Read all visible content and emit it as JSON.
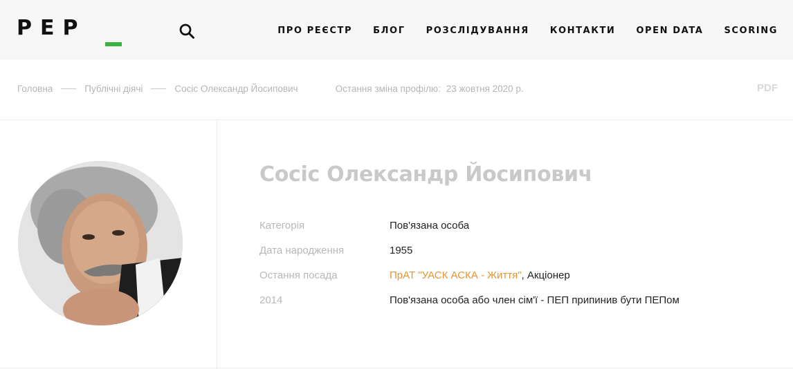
{
  "header": {
    "logo_text": "PEP",
    "nav": [
      {
        "label": "ПРО РЕЄСТР"
      },
      {
        "label": "БЛОГ"
      },
      {
        "label": "РОЗСЛІДУВАННЯ"
      },
      {
        "label": "КОНТАКТИ"
      },
      {
        "label": "OPEN DATA"
      },
      {
        "label": "SCORING"
      }
    ],
    "search_icon": "search-icon",
    "accent_color": "#3fb33f"
  },
  "breadcrumb": {
    "items": [
      "Головна",
      "Публічні діячі",
      "Сосіс Олександр Йосипович"
    ],
    "last_change_label": "Остання зміна профілю:",
    "last_change_value": "23 жовтня 2020 р.",
    "pdf_label": "PDF"
  },
  "profile": {
    "name": "Сосіс Олександр Йосипович",
    "rows": [
      {
        "label": "Категорія",
        "value": "Пов'язана особа"
      },
      {
        "label": "Дата народження",
        "value": "1955"
      },
      {
        "label": "Остання посада",
        "link": "ПрАТ \"УАСК АСКА - Життя\"",
        "suffix": ", Акціонер"
      },
      {
        "label": "2014",
        "value": "Пов'язана особа або член сім'ї - ПЕП припинив бути ПЕПом"
      }
    ],
    "link_color": "#e8942f"
  }
}
